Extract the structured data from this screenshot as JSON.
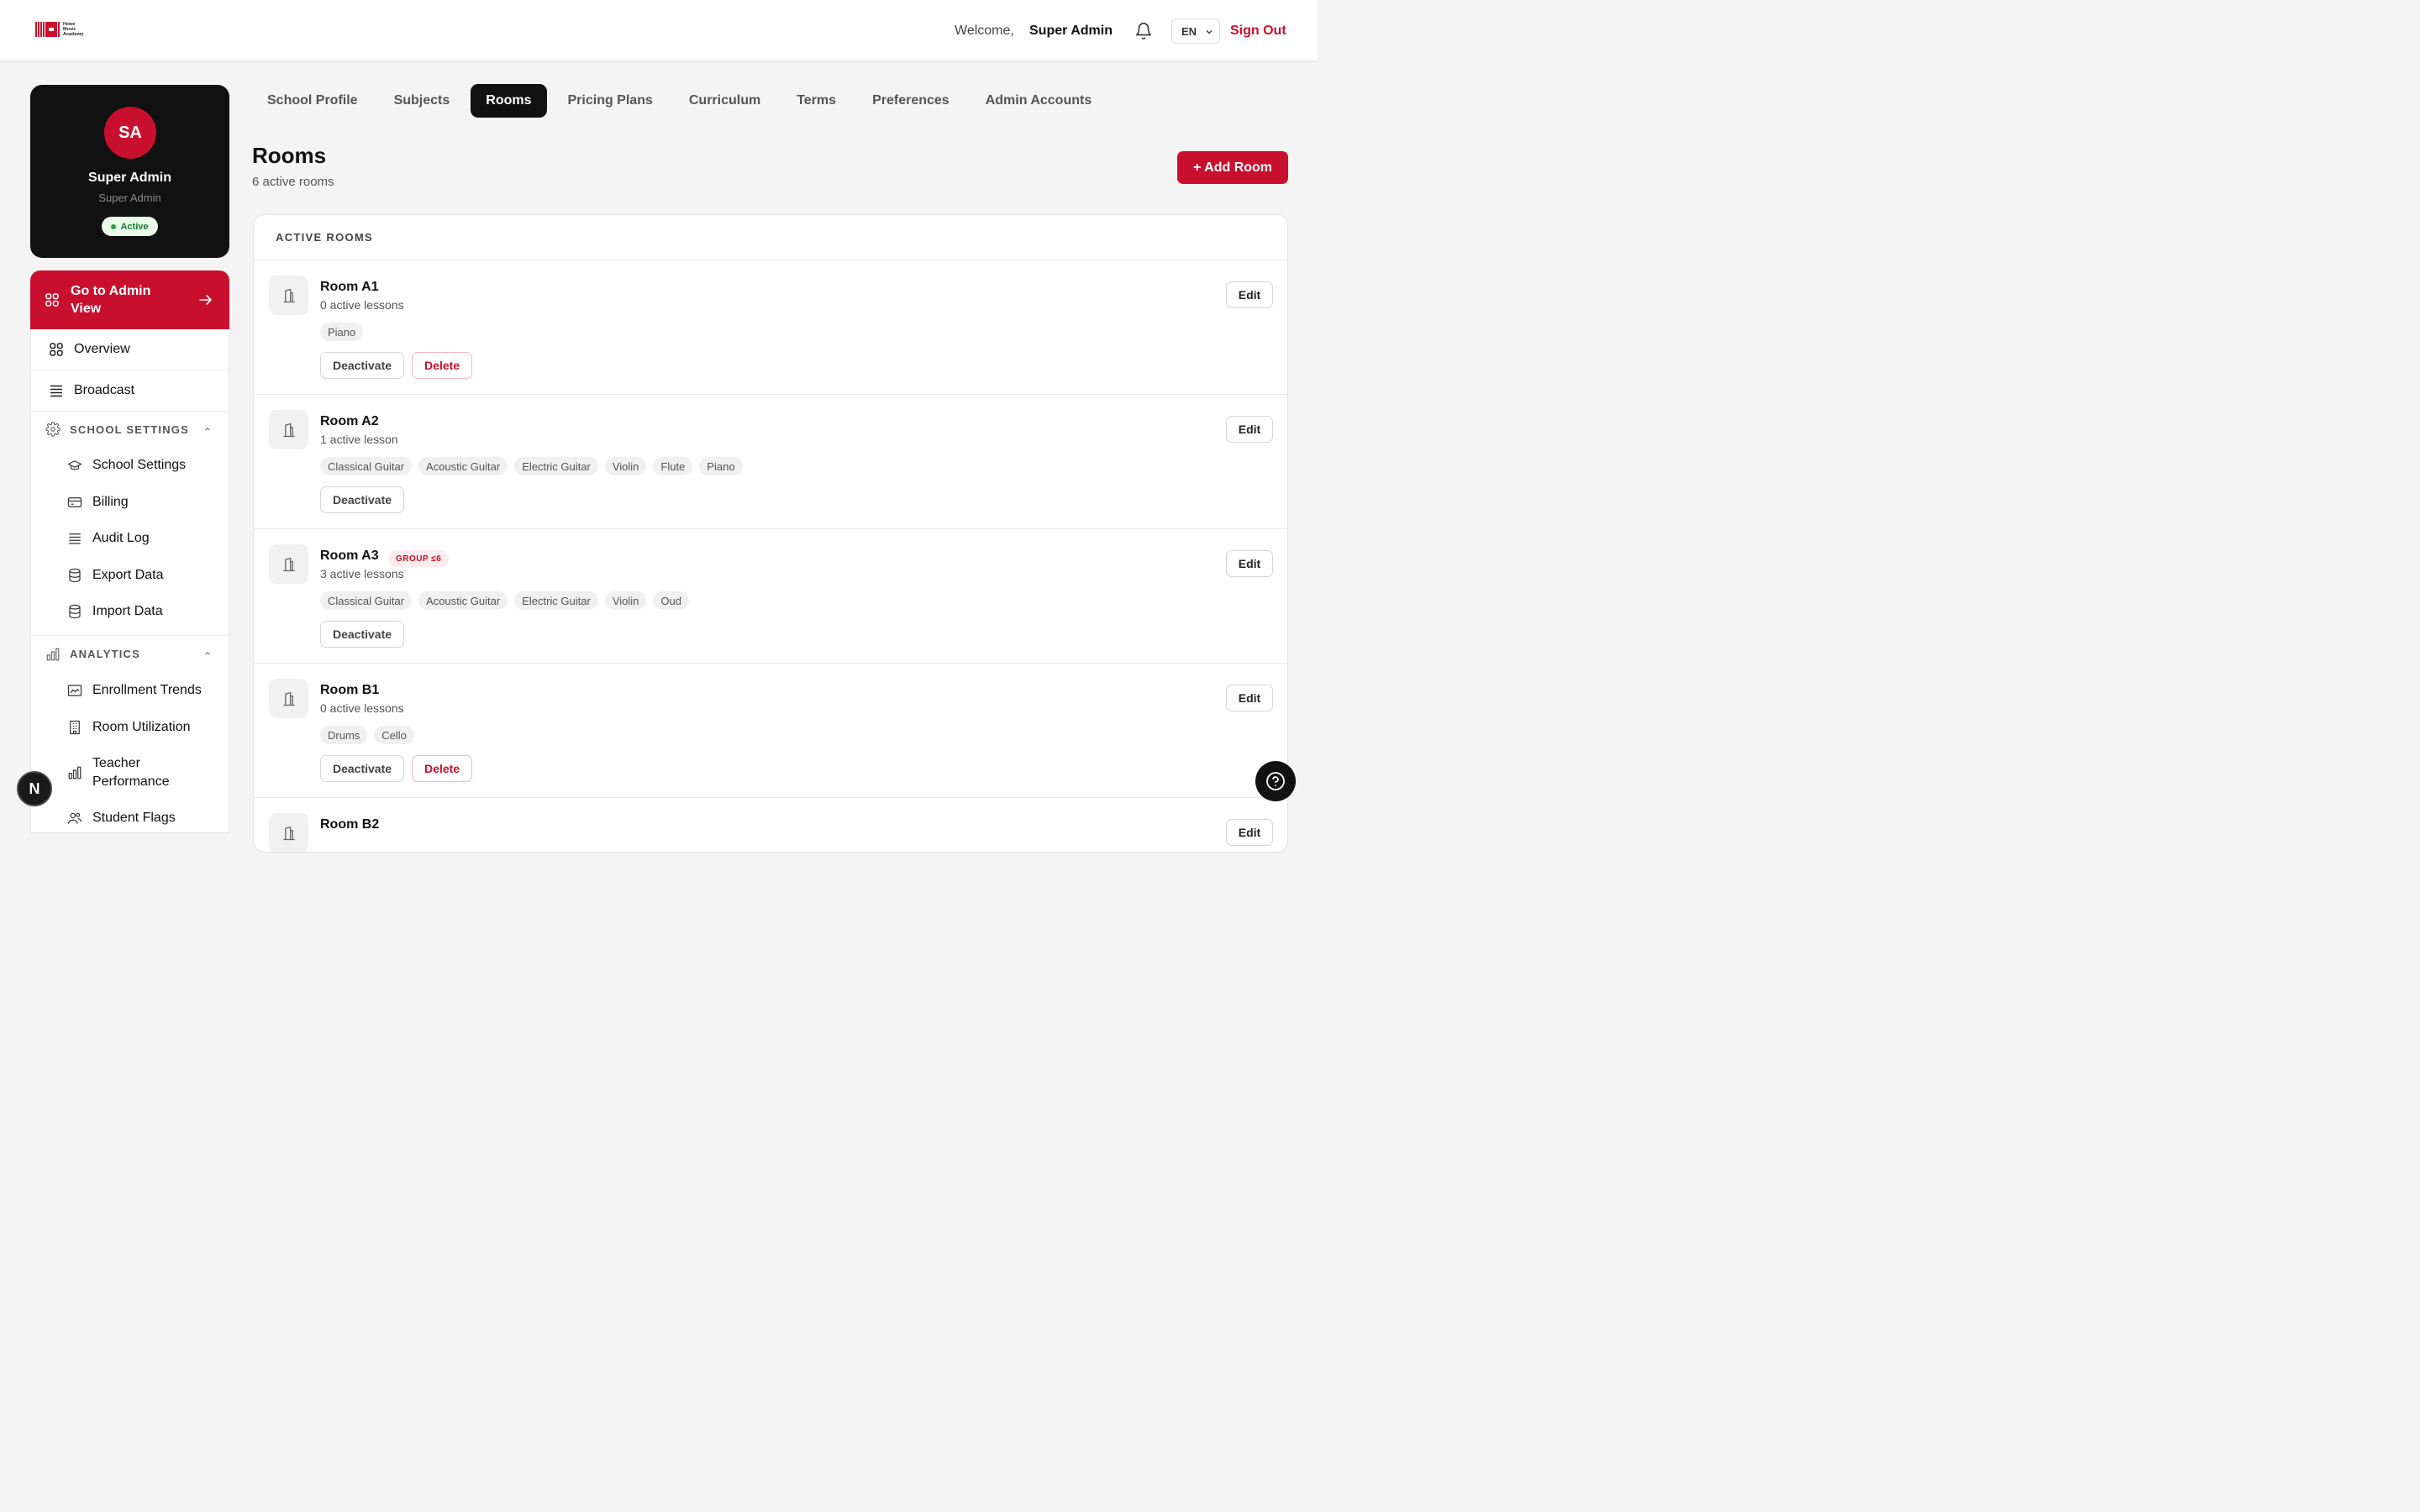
{
  "brand": {
    "logo_lines": [
      "Hewe",
      "Music",
      "Academy"
    ]
  },
  "header": {
    "welcome": "Welcome,",
    "user_name": "Super Admin",
    "language": "EN",
    "sign_out": "Sign Out"
  },
  "profile": {
    "initials": "SA",
    "name": "Super Admin",
    "role": "Super Admin",
    "status": "Active"
  },
  "sidebar": {
    "go_admin": "Go to Admin View",
    "top_items": [
      {
        "label": "Overview",
        "icon": "grid-icon"
      },
      {
        "label": "Broadcast",
        "icon": "list-icon"
      }
    ],
    "sections": [
      {
        "title": "SCHOOL SETTINGS",
        "icon": "gear-icon",
        "items": [
          {
            "label": "School Settings",
            "icon": "graduation-cap-icon"
          },
          {
            "label": "Billing",
            "icon": "credit-card-icon"
          },
          {
            "label": "Audit Log",
            "icon": "list-icon"
          },
          {
            "label": "Export Data",
            "icon": "database-icon"
          },
          {
            "label": "Import Data",
            "icon": "database-icon"
          }
        ]
      },
      {
        "title": "ANALYTICS",
        "icon": "bar-chart-icon",
        "items": [
          {
            "label": "Enrollment Trends",
            "icon": "image-chart-icon"
          },
          {
            "label": "Room Utilization",
            "icon": "building-icon"
          },
          {
            "label": "Teacher Performance",
            "icon": "bar-chart-icon"
          },
          {
            "label": "Student Flags",
            "icon": "users-icon"
          }
        ]
      }
    ]
  },
  "tabs": [
    {
      "label": "School Profile",
      "active": false
    },
    {
      "label": "Subjects",
      "active": false
    },
    {
      "label": "Rooms",
      "active": true
    },
    {
      "label": "Pricing Plans",
      "active": false
    },
    {
      "label": "Curriculum",
      "active": false
    },
    {
      "label": "Terms",
      "active": false
    },
    {
      "label": "Preferences",
      "active": false
    },
    {
      "label": "Admin Accounts",
      "active": false
    }
  ],
  "page": {
    "title": "Rooms",
    "subtitle": "6 active rooms",
    "add_button": "+ Add Room"
  },
  "panel": {
    "heading": "ACTIVE ROOMS"
  },
  "labels": {
    "edit": "Edit",
    "deactivate": "Deactivate",
    "delete": "Delete"
  },
  "rooms": [
    {
      "name": "Room A1",
      "lessons": "0 active lessons",
      "badge": "",
      "tags": [
        "Piano"
      ],
      "can_delete": true
    },
    {
      "name": "Room A2",
      "lessons": "1 active lesson",
      "badge": "",
      "tags": [
        "Classical Guitar",
        "Acoustic Guitar",
        "Electric Guitar",
        "Violin",
        "Flute",
        "Piano"
      ],
      "can_delete": false
    },
    {
      "name": "Room A3",
      "lessons": "3 active lessons",
      "badge": "GROUP ≤6",
      "tags": [
        "Classical Guitar",
        "Acoustic Guitar",
        "Electric Guitar",
        "Violin",
        "Oud"
      ],
      "can_delete": false
    },
    {
      "name": "Room B1",
      "lessons": "0 active lessons",
      "badge": "",
      "tags": [
        "Drums",
        "Cello"
      ],
      "can_delete": true
    },
    {
      "name": "Room B2",
      "lessons": "",
      "badge": "",
      "tags": [],
      "can_delete": false
    }
  ],
  "floating": {
    "next_badge": "N"
  },
  "colors": {
    "accent": "#c8102e",
    "dark": "#111111",
    "page_bg": "#f4f4f5"
  }
}
